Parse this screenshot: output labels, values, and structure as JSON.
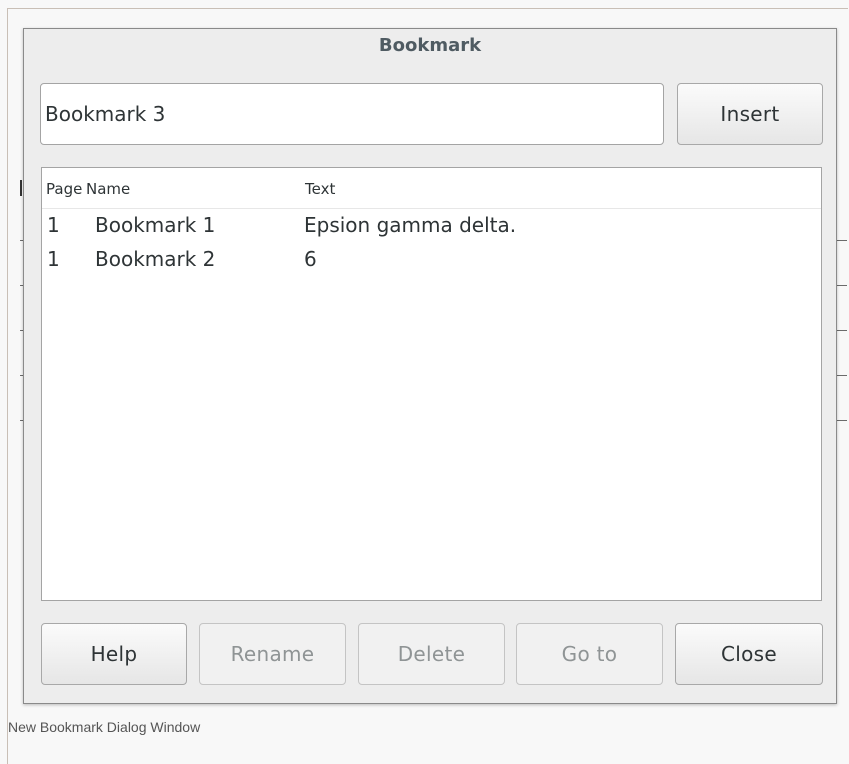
{
  "dialog": {
    "title": "Bookmark",
    "name_value": "Bookmark 3",
    "insert_label": "Insert"
  },
  "list": {
    "columns": {
      "page": "Page",
      "name": "Name",
      "text": "Text"
    },
    "rows": [
      {
        "page": "1",
        "name": "Bookmark 1",
        "text": "Epsion gamma delta."
      },
      {
        "page": "1",
        "name": "Bookmark 2",
        "text": "6"
      }
    ]
  },
  "buttons": {
    "help": "Help",
    "rename": "Rename",
    "delete": "Delete",
    "goto": "Go to",
    "close": "Close"
  },
  "caption": "New Bookmark Dialog Window",
  "colors": {
    "title_text": "#4f5b62",
    "disabled_text": "#8f9495",
    "dialog_bg": "#ededed"
  }
}
